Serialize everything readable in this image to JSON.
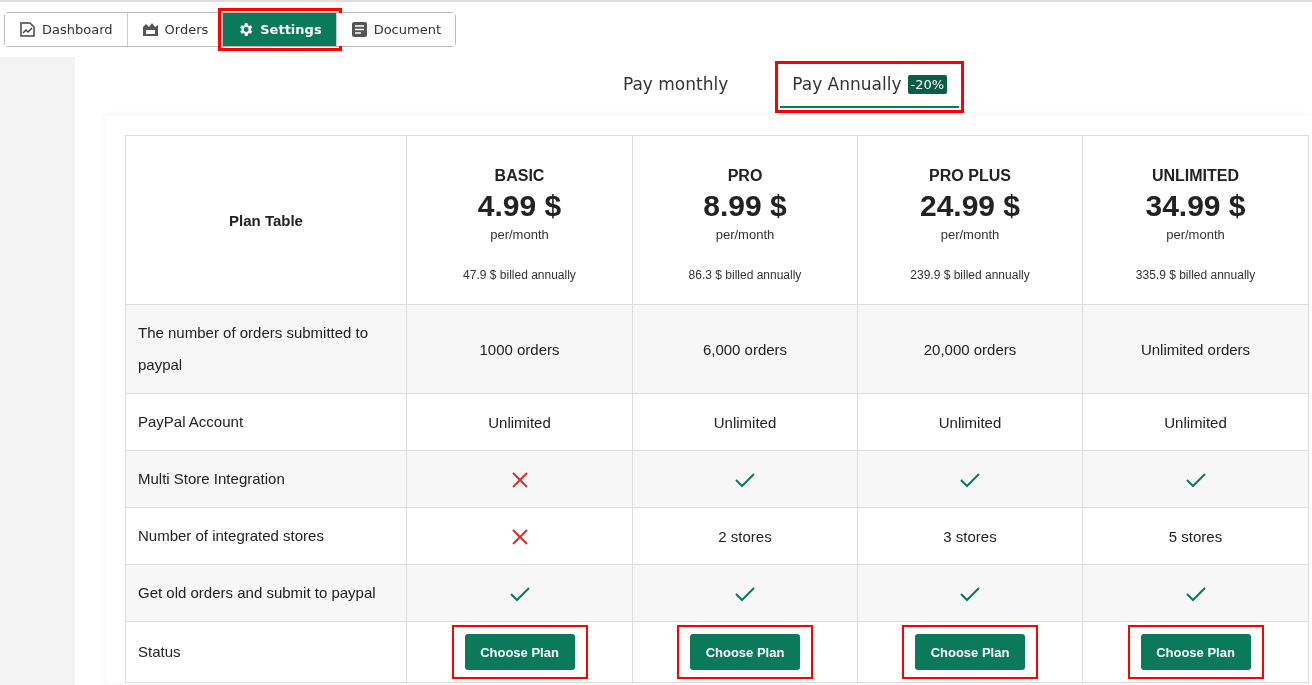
{
  "nav": [
    {
      "label": "Dashboard",
      "selected": false,
      "highlighted": false
    },
    {
      "label": "Orders",
      "selected": false,
      "highlighted": false
    },
    {
      "label": "Settings",
      "selected": true,
      "highlighted": true
    },
    {
      "label": "Document",
      "selected": false,
      "highlighted": false
    }
  ],
  "billing_tabs": [
    {
      "label": "Pay monthly",
      "selected": false,
      "highlighted": false
    },
    {
      "label": "Pay Annually",
      "badge": "-20%",
      "selected": true,
      "highlighted": true
    }
  ],
  "table": {
    "corner": "Plan Table",
    "plans": [
      {
        "name": "BASIC",
        "price": "4.99 $",
        "period": "per/month",
        "billed": "47.9 $ billed annually"
      },
      {
        "name": "PRO",
        "price": "8.99 $",
        "period": "per/month",
        "billed": "86.3 $ billed annually"
      },
      {
        "name": "PRO PLUS",
        "price": "24.99 $",
        "period": "per/month",
        "billed": "239.9 $ billed annually"
      },
      {
        "name": "UNLIMITED",
        "price": "34.99 $",
        "period": "per/month",
        "billed": "335.9 $ billed annually"
      }
    ],
    "rows": [
      {
        "label": "The number of orders submitted to paypal",
        "cells": [
          {
            "kind": "text",
            "text": "1000 orders"
          },
          {
            "kind": "text",
            "text": "6,000 orders"
          },
          {
            "kind": "text",
            "text": "20,000 orders"
          },
          {
            "kind": "text",
            "text": "Unlimited orders"
          }
        ]
      },
      {
        "label": "PayPal Account",
        "cells": [
          {
            "kind": "text",
            "text": "Unlimited"
          },
          {
            "kind": "text",
            "text": "Unlimited"
          },
          {
            "kind": "text",
            "text": "Unlimited"
          },
          {
            "kind": "text",
            "text": "Unlimited"
          }
        ]
      },
      {
        "label": "Multi Store Integration",
        "cells": [
          {
            "kind": "cross"
          },
          {
            "kind": "check"
          },
          {
            "kind": "check"
          },
          {
            "kind": "check"
          }
        ]
      },
      {
        "label": "Number of integrated stores",
        "cells": [
          {
            "kind": "cross"
          },
          {
            "kind": "text",
            "text": "2 stores"
          },
          {
            "kind": "text",
            "text": "3 stores"
          },
          {
            "kind": "text",
            "text": "5 stores"
          }
        ]
      },
      {
        "label": "Get old orders and submit to paypal",
        "cells": [
          {
            "kind": "check"
          },
          {
            "kind": "check"
          },
          {
            "kind": "check"
          },
          {
            "kind": "check"
          }
        ]
      },
      {
        "label": "Status",
        "cells": [
          {
            "kind": "button",
            "text": "Choose Plan",
            "highlighted": true
          },
          {
            "kind": "button",
            "text": "Choose Plan",
            "highlighted": true
          },
          {
            "kind": "button",
            "text": "Choose Plan",
            "highlighted": true
          },
          {
            "kind": "button",
            "text": "Choose Plan",
            "highlighted": true
          }
        ]
      }
    ]
  }
}
